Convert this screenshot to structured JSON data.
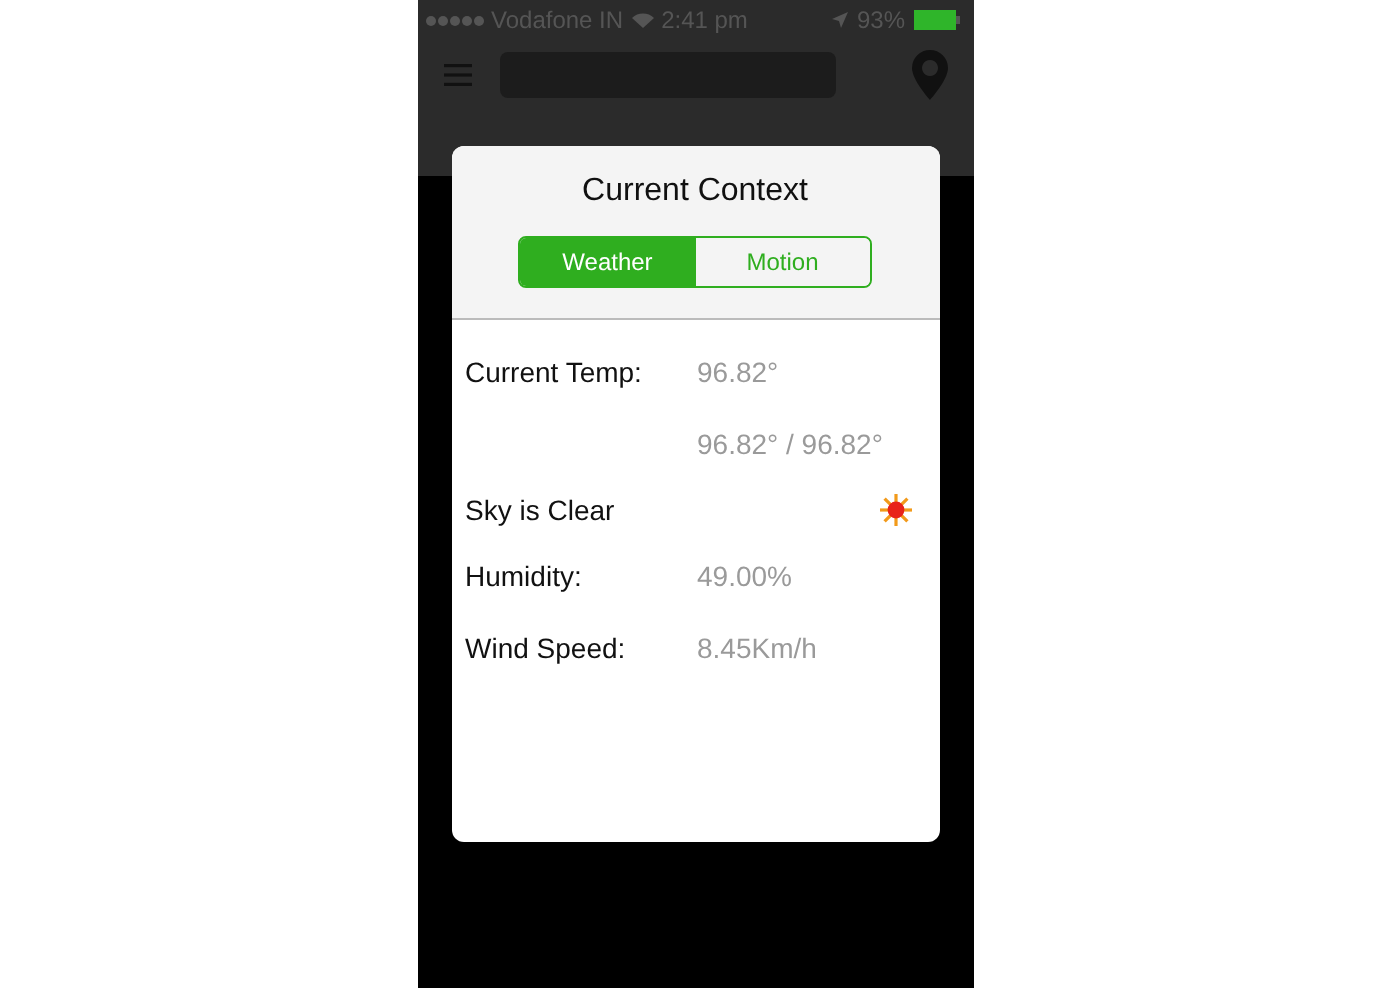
{
  "status_bar": {
    "carrier": "Vodafone IN",
    "time": "2:41 pm",
    "battery": "93%"
  },
  "dialog": {
    "title": "Current Context",
    "tabs": [
      {
        "label": "Weather",
        "selected": true
      },
      {
        "label": "Motion",
        "selected": false
      }
    ],
    "rows": [
      {
        "kind": "pair",
        "label": "Current Temp:",
        "value": "96.82°"
      },
      {
        "kind": "value",
        "value": "96.82° / 96.82°"
      },
      {
        "kind": "condition",
        "label": "Sky is Clear"
      },
      {
        "kind": "pair",
        "label": "Humidity:",
        "value": "49.00%"
      },
      {
        "kind": "pair",
        "label": "Wind Speed:",
        "value": "8.45Km/h"
      }
    ]
  }
}
